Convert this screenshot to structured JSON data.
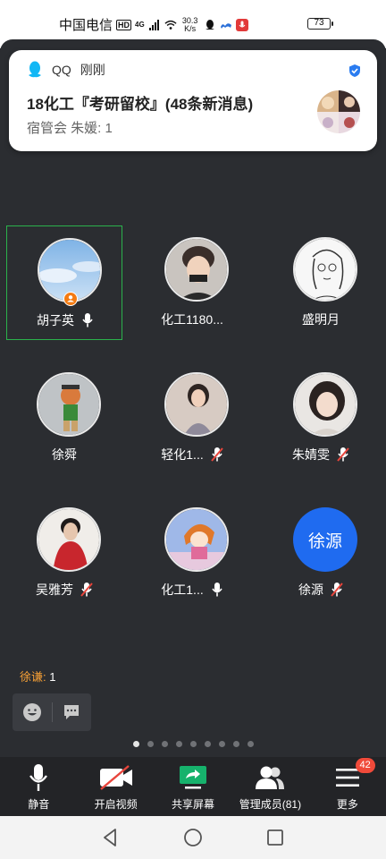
{
  "status_bar": {
    "carrier": "中国电信",
    "hd": "HD",
    "network": "4G",
    "speed_top": "30.3",
    "speed_bottom": "K/s",
    "battery": "73"
  },
  "notification": {
    "app_name": "QQ",
    "time": "刚刚",
    "title": "18化工『考研留校』(48条新消息)",
    "body": "宿管会 朱媛: 1"
  },
  "participants": [
    {
      "name": "胡子英",
      "mic": "on",
      "host": true,
      "active": true,
      "avatar": "sky-photo"
    },
    {
      "name": "化工1180...",
      "mic": "none",
      "host": false,
      "active": false,
      "avatar": "person-photo"
    },
    {
      "name": "盛明月",
      "mic": "none",
      "host": false,
      "active": false,
      "avatar": "line-drawing"
    },
    {
      "name": "徐舜",
      "mic": "none",
      "host": false,
      "active": false,
      "avatar": "toy-figure"
    },
    {
      "name": "轻化1...",
      "mic": "muted",
      "host": false,
      "active": false,
      "avatar": "girl-photo"
    },
    {
      "name": "朱婧雯",
      "mic": "muted",
      "host": false,
      "active": false,
      "avatar": "girl-selfie"
    },
    {
      "name": "吴雅芳",
      "mic": "muted",
      "host": false,
      "active": false,
      "avatar": "boy-red-jacket"
    },
    {
      "name": "化工1...",
      "mic": "on",
      "host": false,
      "active": false,
      "avatar": "cartoon-girl"
    },
    {
      "name": "徐源",
      "mic": "muted",
      "host": false,
      "active": false,
      "avatar_text": "徐源"
    }
  ],
  "chat": {
    "sender": "徐谦:",
    "message": "1"
  },
  "pagination": {
    "total": 9,
    "current": 1
  },
  "toolbar": {
    "mute_label": "静音",
    "video_label": "开启视频",
    "share_label": "共享屏幕",
    "members_label": "管理成员(81)",
    "more_label": "更多",
    "more_badge": "42"
  },
  "colors": {
    "background": "#2b2d31",
    "toolbar": "#232427",
    "active_border": "#2bb24c",
    "accent_blue": "#1f6bf0",
    "muted_red": "#e8453c",
    "chat_name": "#f7a035",
    "share_green": "#16b26c"
  }
}
